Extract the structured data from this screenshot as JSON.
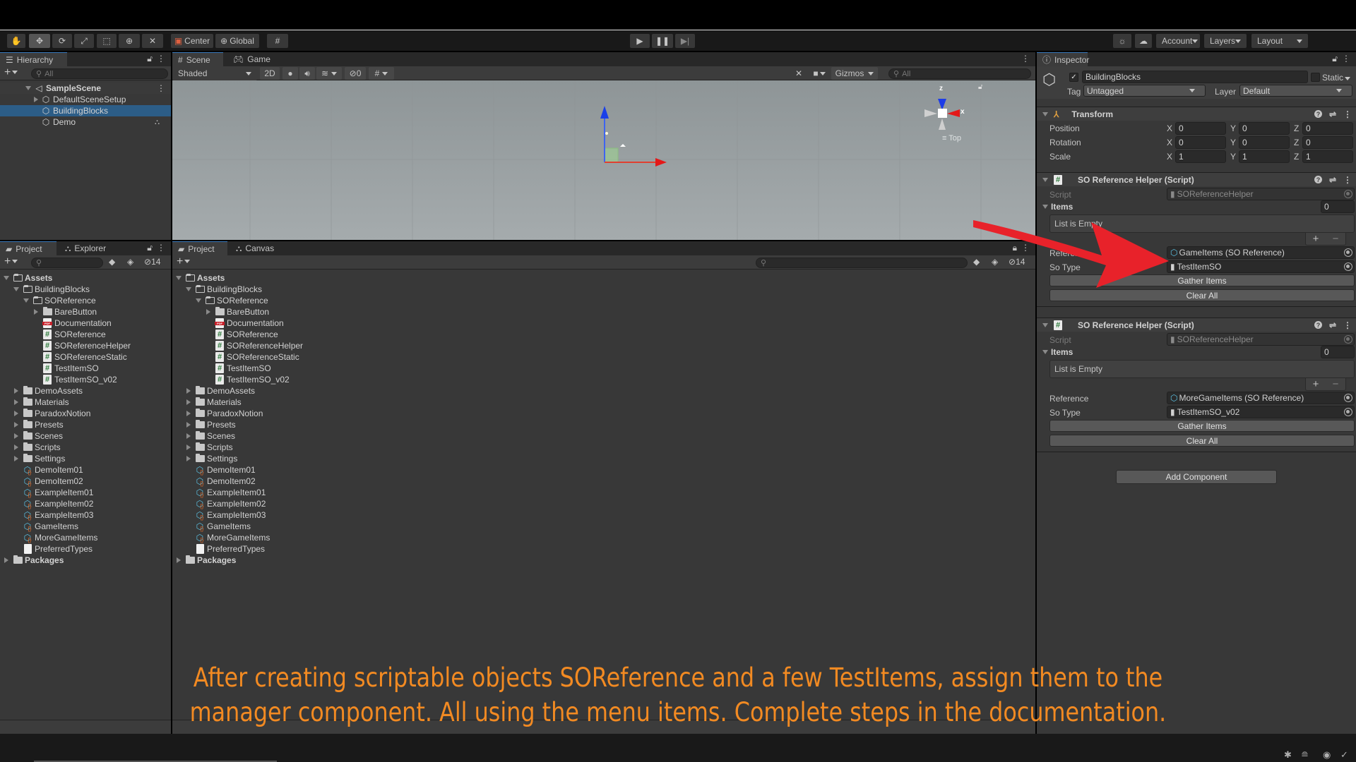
{
  "toolbar": {
    "tools": [
      "hand-tool",
      "move-tool",
      "rotate-tool",
      "scale-tool",
      "rect-tool",
      "transform-tool",
      "custom-tool"
    ],
    "pivot_label": "Center",
    "space_label": "Global",
    "account_label": "Account",
    "layers_label": "Layers",
    "layout_label": "Layout"
  },
  "hierarchy": {
    "tab_label": "Hierarchy",
    "search_placeholder": "All",
    "scene": "SampleScene",
    "items": [
      {
        "label": "DefaultSceneSetup",
        "expandable": true,
        "selected": false
      },
      {
        "label": "BuildingBlocks",
        "expandable": false,
        "selected": true
      },
      {
        "label": "Demo",
        "expandable": false,
        "selected": false
      }
    ]
  },
  "scene_view": {
    "tabs": [
      "Scene",
      "Game"
    ],
    "shading_mode": "Shaded",
    "mode_2d": "2D",
    "hidden_count": "0",
    "gizmos_label": "Gizmos",
    "search_placeholder": "All",
    "view_label": "Top",
    "axis_z": "z",
    "axis_x": "x"
  },
  "project_left": {
    "tabs": [
      "Project",
      "Explorer"
    ],
    "hidden_count": "14"
  },
  "project_main": {
    "tabs": [
      "Project",
      "Canvas"
    ],
    "hidden_count": "14"
  },
  "assets_tree": {
    "root": "Assets",
    "building_blocks": "BuildingBlocks",
    "so_reference": "SOReference",
    "so_children": [
      {
        "label": "BareButton",
        "type": "folder"
      },
      {
        "label": "Documentation",
        "type": "pdf"
      },
      {
        "label": "SOReference",
        "type": "script"
      },
      {
        "label": "SOReferenceHelper",
        "type": "script"
      },
      {
        "label": "SOReferenceStatic",
        "type": "script"
      },
      {
        "label": "TestItemSO",
        "type": "script"
      },
      {
        "label": "TestItemSO_v02",
        "type": "script"
      }
    ],
    "folders": [
      "DemoAssets",
      "Materials",
      "ParadoxNotion",
      "Presets",
      "Scenes",
      "Scripts",
      "Settings"
    ],
    "assets": [
      "DemoItem01",
      "DemoItem02",
      "ExampleItem01",
      "ExampleItem02",
      "ExampleItem03",
      "GameItems",
      "MoreGameItems"
    ],
    "text_asset": "PreferredTypes",
    "packages": "Packages"
  },
  "inspector": {
    "tab_label": "Inspector",
    "object_name": "BuildingBlocks",
    "active": true,
    "static_label": "Static",
    "tag_label": "Tag",
    "tag_value": "Untagged",
    "layer_label": "Layer",
    "layer_value": "Default",
    "transform": {
      "title": "Transform",
      "rows": [
        {
          "label": "Position",
          "x": "0",
          "y": "0",
          "z": "0"
        },
        {
          "label": "Rotation",
          "x": "0",
          "y": "0",
          "z": "0"
        },
        {
          "label": "Scale",
          "x": "1",
          "y": "1",
          "z": "1"
        }
      ]
    },
    "components": [
      {
        "title": "SO Reference Helper (Script)",
        "script_label": "Script",
        "script_value": "SOReferenceHelper",
        "items_label": "Items",
        "items_count": "0",
        "list_empty": "List is Empty",
        "reference_label": "Reference",
        "reference_value": "GameItems (SO Reference)",
        "sotype_label": "So Type",
        "sotype_value": "TestItemSO",
        "gather_label": "Gather Items",
        "clear_label": "Clear All"
      },
      {
        "title": "SO Reference Helper (Script)",
        "script_label": "Script",
        "script_value": "SOReferenceHelper",
        "items_label": "Items",
        "items_count": "0",
        "list_empty": "List is Empty",
        "reference_label": "Reference",
        "reference_value": "MoreGameItems (SO Reference)",
        "sotype_label": "So Type",
        "sotype_value": "TestItemSO_v02",
        "gather_label": "Gather Items",
        "clear_label": "Clear All"
      }
    ],
    "add_component_label": "Add Component"
  },
  "caption": {
    "line1": "After creating scriptable objects SOReference and a few TestItems, assign them to the",
    "line2": "manager component. All using the menu items. Complete steps in the documentation."
  },
  "colors": {
    "annotation_arrow": "#e8222a",
    "caption": "#f28a22",
    "selection": "#2c5d87"
  }
}
